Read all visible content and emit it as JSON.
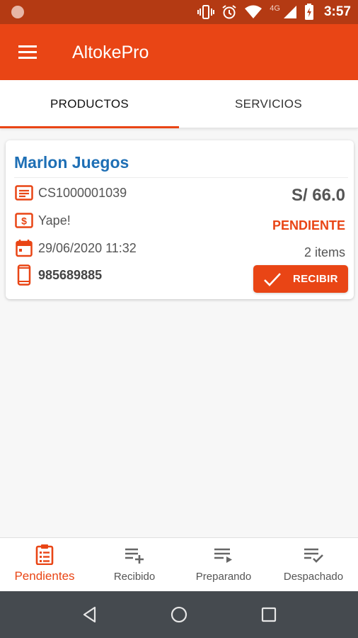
{
  "status_bar": {
    "network": "4G",
    "time": "3:57",
    "icons": [
      "vibrate-icon",
      "alarm-icon",
      "wifi-icon",
      "signal-icon",
      "battery-icon"
    ]
  },
  "app_bar": {
    "title": "AltokePro",
    "menu_icon": "hamburger-menu-icon"
  },
  "tabs": [
    {
      "label": "PRODUCTOS",
      "active": true
    },
    {
      "label": "SERVICIOS",
      "active": false
    }
  ],
  "order": {
    "customer": "Marlon Juegos",
    "code": "CS1000001039",
    "payment_method": "Yape!",
    "datetime": "29/06/2020 11:32",
    "phone": "985689885",
    "amount": "S/ 66.0",
    "status": "PENDIENTE",
    "items": "2 items",
    "action_label": "RECIBIR"
  },
  "bottom_nav": [
    {
      "label": "Pendientes",
      "icon": "clipboard-list-icon",
      "active": true
    },
    {
      "label": "Recibido",
      "icon": "playlist-add-icon",
      "active": false
    },
    {
      "label": "Preparando",
      "icon": "playlist-play-icon",
      "active": false
    },
    {
      "label": "Despachado",
      "icon": "playlist-check-icon",
      "active": false
    }
  ],
  "colors": {
    "primary": "#e94515",
    "status_bar": "#b43a13",
    "customer_name": "#1e6fb5",
    "system_nav": "#454a4f"
  }
}
